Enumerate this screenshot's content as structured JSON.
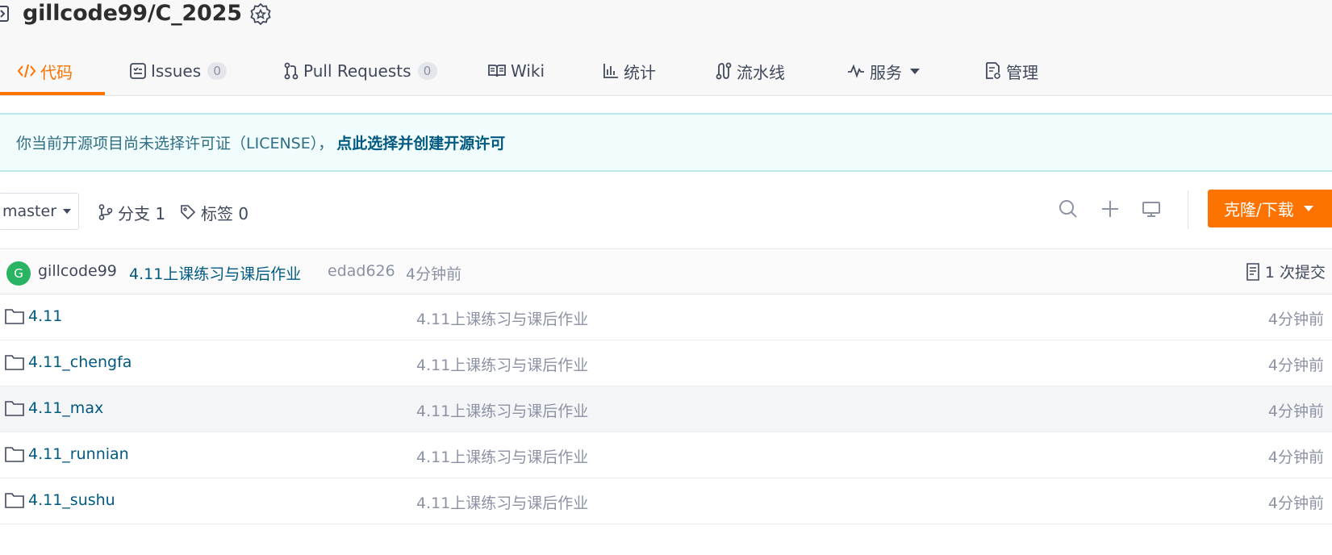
{
  "repo": {
    "title": "gillcode99/C_2025"
  },
  "tabs": [
    {
      "label": "代码",
      "icon": "code-icon",
      "active": true
    },
    {
      "label": "Issues",
      "icon": "issues-icon",
      "badge": "0"
    },
    {
      "label": "Pull Requests",
      "icon": "pull-request-icon",
      "badge": "0"
    },
    {
      "label": "Wiki",
      "icon": "book-icon"
    },
    {
      "label": "统计",
      "icon": "bar-chart-icon"
    },
    {
      "label": "流水线",
      "icon": "pipeline-icon"
    },
    {
      "label": "服务",
      "icon": "activity-icon",
      "dropdown": true
    },
    {
      "label": "管理",
      "icon": "settings-doc-icon"
    }
  ],
  "license_banner": {
    "text": "你当前开源项目尚未选择许可证（LICENSE），",
    "link": "点此选择并创建开源许可"
  },
  "toolbar": {
    "branch": "master",
    "branches_label": "分支 1",
    "tags_label": "标签 0",
    "clone_label": "克隆/下载"
  },
  "last_commit": {
    "avatar_letter": "G",
    "author": "gillcode99",
    "message": "4.11上课练习与课后作业",
    "hash": "edad626",
    "time": "4分钟前",
    "count_label": "1 次提交"
  },
  "files": [
    {
      "name": "4.11",
      "commit": "4.11上课练习与课后作业",
      "time": "4分钟前"
    },
    {
      "name": "4.11_chengfa",
      "commit": "4.11上课练习与课后作业",
      "time": "4分钟前"
    },
    {
      "name": "4.11_max",
      "commit": "4.11上课练习与课后作业",
      "time": "4分钟前"
    },
    {
      "name": "4.11_runnian",
      "commit": "4.11上课练习与课后作业",
      "time": "4分钟前"
    },
    {
      "name": "4.11_sushu",
      "commit": "4.11上课练习与课后作业",
      "time": "4分钟前"
    }
  ],
  "colors": {
    "accent": "#fe7300",
    "link": "#005980",
    "banner_bg": "#f1fcfd",
    "avatar": "#28b462"
  }
}
